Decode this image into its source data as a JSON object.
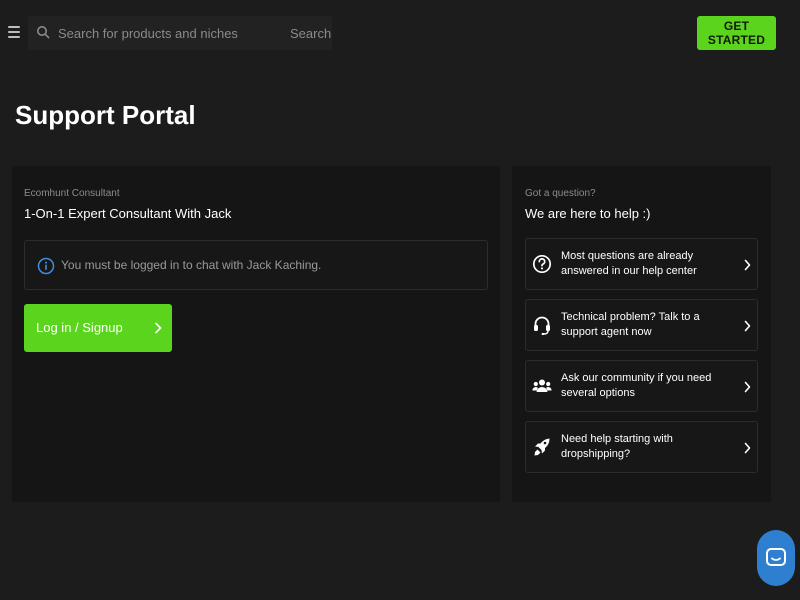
{
  "header": {
    "search": {
      "placeholder": "Search for products and niches",
      "button_label": "Search"
    },
    "cta_label": "GET STARTED",
    "accent_color": "#5bd41e"
  },
  "page": {
    "title": "Support Portal"
  },
  "consultant_panel": {
    "eyebrow": "Ecomhunt Consultant",
    "heading": "1-On-1 Expert Consultant With Jack",
    "notice": {
      "icon": "info-icon",
      "text": "You must be logged in to chat with Jack Kaching."
    },
    "login_button": {
      "label": "Log in / Signup",
      "icon": "chevron-right-icon"
    }
  },
  "help_panel": {
    "eyebrow": "Got a question?",
    "heading": "We are here to help :)",
    "items": [
      {
        "icon": "question-circle-icon",
        "text": "Most questions are already answered in our help center"
      },
      {
        "icon": "headset-icon",
        "text": "Technical problem? Talk to a support agent now"
      },
      {
        "icon": "users-icon",
        "text": "Ask our community if you need several options"
      },
      {
        "icon": "rocket-icon",
        "text": "Need help starting with dropshipping?"
      }
    ]
  },
  "chat_widget": {
    "icon": "chat-icon",
    "color": "#2f7fd1"
  }
}
